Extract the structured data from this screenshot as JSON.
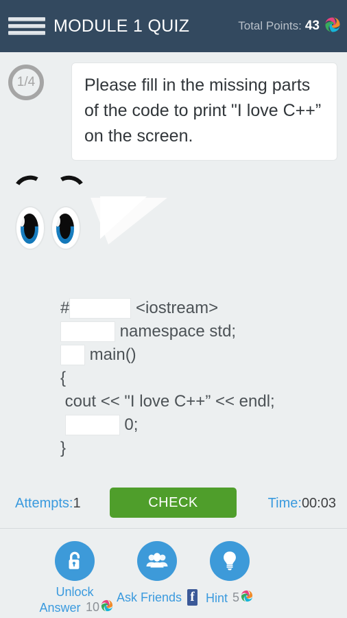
{
  "header": {
    "menu_icon": "hamburger-icon",
    "title": "MODULE 1 QUIZ",
    "points_label": "Total Points:",
    "points_value": "43",
    "coin_icon": "coin-swirl-icon",
    "background_color": "#33495f"
  },
  "question": {
    "step_badge": "1/4",
    "prompt": "Please fill in the missing parts of the code to print \"I love C++” on the screen."
  },
  "character": {
    "eyes_icon": "cartoon-eyes",
    "eye_color": "#1277b8"
  },
  "code": {
    "lines": [
      {
        "id": "line-include",
        "prefix": "#",
        "blank": "wide",
        "suffix": " <iostream>"
      },
      {
        "id": "line-using",
        "prefix": "",
        "blank": "mid",
        "suffix": " namespace std;"
      },
      {
        "id": "line-main",
        "prefix": "",
        "blank": "small",
        "suffix": " main()"
      },
      {
        "id": "line-open",
        "prefix": "{",
        "blank": null,
        "suffix": ""
      },
      {
        "id": "line-cout",
        "prefix": " cout << \"I love C++” << endl;",
        "blank": null,
        "suffix": ""
      },
      {
        "id": "line-return",
        "prefix": " ",
        "blank": "ret",
        "suffix": " 0;"
      },
      {
        "id": "line-close",
        "prefix": "}",
        "blank": null,
        "suffix": ""
      }
    ]
  },
  "controls": {
    "attempts_label": "Attempts:",
    "attempts_value": "1",
    "check_label": "CHECK",
    "time_label": "Time:",
    "time_value": "00:03",
    "check_color": "#4f9e2b"
  },
  "actions": [
    {
      "id": "unlock-answer",
      "icon": "unlock-padlock-icon",
      "label_line1": "Unlock",
      "label_line2": "Answer",
      "cost": "10",
      "cost_icon": "coin-swirl-icon"
    },
    {
      "id": "ask-friends",
      "icon": "people-group-icon",
      "label_line1": "Ask Friends",
      "label_line2": "",
      "cost": "",
      "cost_icon": "facebook-icon",
      "facebook_glyph": "f"
    },
    {
      "id": "hint",
      "icon": "lightbulb-icon",
      "label_line1": "Hint",
      "label_line2": "",
      "cost": "5",
      "cost_icon": "coin-swirl-icon"
    }
  ],
  "theme": {
    "page_background": "#eceff0",
    "accent_blue": "#3a9ade",
    "text_dark": "#3e3f41"
  }
}
